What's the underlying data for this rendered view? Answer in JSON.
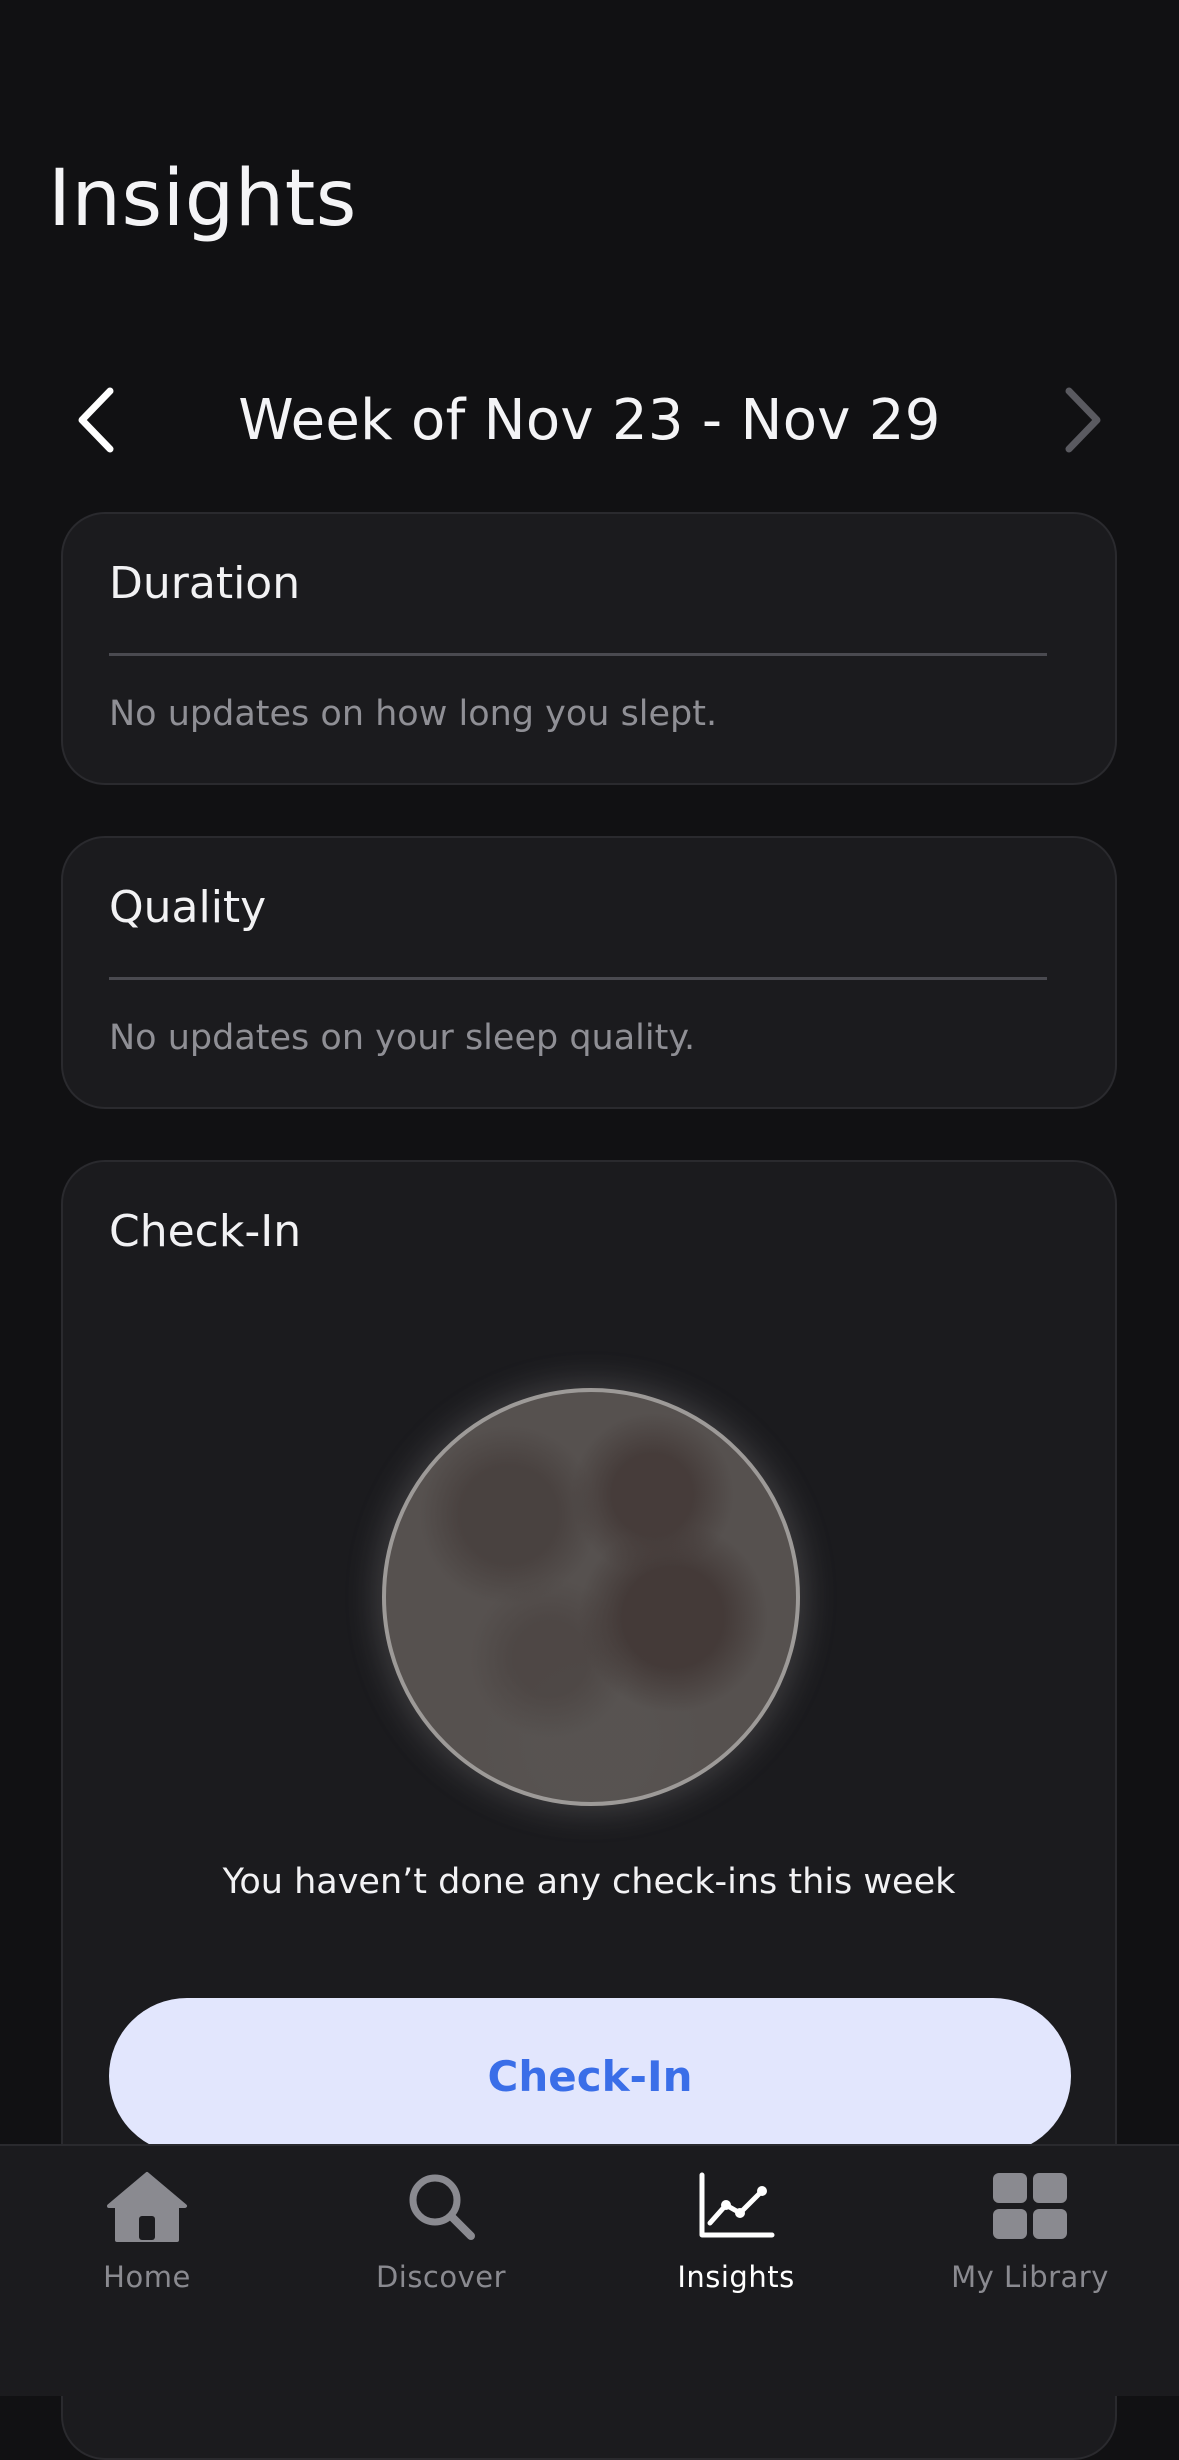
{
  "header": {
    "title": "Insights"
  },
  "week_nav": {
    "label": "Week of Nov 23 - Nov 29",
    "prev_icon": "chevron-left-icon",
    "next_icon": "chevron-right-icon"
  },
  "cards": {
    "duration": {
      "title": "Duration",
      "empty_text": "No updates on how long you slept."
    },
    "quality": {
      "title": "Quality",
      "empty_text": "No updates on your sleep quality."
    },
    "checkin": {
      "title": "Check-In",
      "message": "You haven’t done any check-ins this week",
      "button_label": "Check-In",
      "illustration": "moon-icon"
    }
  },
  "tab_bar": {
    "tabs": [
      {
        "label": "Home",
        "icon": "home-icon",
        "active": false
      },
      {
        "label": "Discover",
        "icon": "search-icon",
        "active": false
      },
      {
        "label": "Insights",
        "icon": "chart-icon",
        "active": true
      },
      {
        "label": "My Library",
        "icon": "grid-icon",
        "active": false
      }
    ]
  },
  "colors": {
    "background": "#111113",
    "card": "#1b1b1e",
    "accent": "#3a6ee8",
    "button_bg": "#e2e6fd",
    "muted_text": "#8f8f95"
  }
}
